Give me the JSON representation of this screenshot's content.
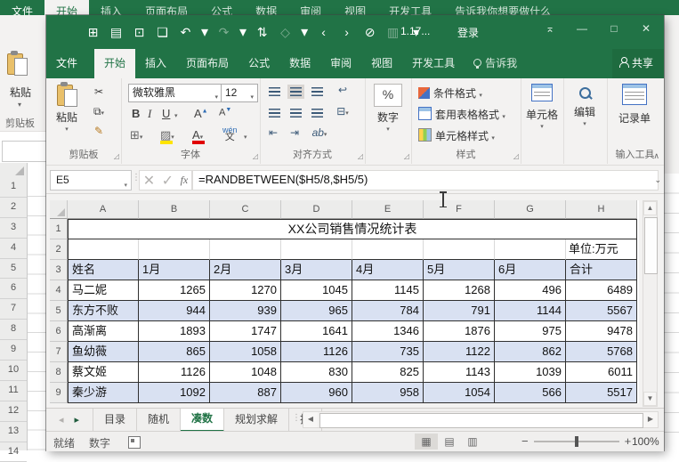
{
  "colors": {
    "excel_green": "#217346",
    "share_green": "#1e6b3f",
    "table_header_fill": "#d9e1f2",
    "table_border": "#303030",
    "active_sheet_tab_green": "#217346"
  },
  "background_window": {
    "top_tabs": [
      {
        "label": "文件",
        "kind": "file"
      },
      {
        "label": "开始",
        "active": true
      },
      {
        "label": "插入"
      },
      {
        "label": "页面布局"
      },
      {
        "label": "公式"
      },
      {
        "label": "数据"
      },
      {
        "label": "审阅"
      },
      {
        "label": "视图"
      },
      {
        "label": "开发工具"
      },
      {
        "label": "告诉我你想要做什么",
        "kind": "tellme"
      }
    ],
    "paste_label": "粘贴",
    "paste_dropdown": "▾",
    "clipboard_group_label": "剪贴板",
    "row_numbers": [
      "1",
      "2",
      "3",
      "4",
      "5",
      "6",
      "7",
      "8",
      "9",
      "10",
      "11",
      "12",
      "13",
      "14"
    ]
  },
  "title_bar": {
    "qat_icons": [
      {
        "name": "form-button-icon",
        "glyph": "⊞"
      },
      {
        "name": "save-icon",
        "glyph": "▤"
      },
      {
        "name": "quick-print-icon",
        "glyph": "⊡"
      },
      {
        "name": "print-preview-icon",
        "glyph": "❏"
      },
      {
        "name": "undo-icon",
        "glyph": "↶",
        "dropdown": true
      },
      {
        "name": "redo-icon",
        "glyph": "↷",
        "dropdown": true,
        "disabled": true
      },
      {
        "name": "sort-ascending-icon",
        "glyph": "⇅"
      },
      {
        "name": "shapes-icon",
        "glyph": "◇",
        "dropdown": true,
        "disabled": true
      },
      {
        "name": "previous-comment-icon",
        "glyph": "‹"
      },
      {
        "name": "next-comment-icon",
        "glyph": "›"
      },
      {
        "name": "delete-comment-icon",
        "glyph": "⊘"
      },
      {
        "name": "paste-special-icon",
        "glyph": "▥",
        "disabled": true
      },
      {
        "name": "qat-customize-icon",
        "glyph": "▾"
      }
    ],
    "document_title": "1.17...",
    "sign_in_label": "登录",
    "window_controls": [
      {
        "name": "ribbon-display-options-icon",
        "glyph": "⌅"
      },
      {
        "name": "minimize-icon",
        "glyph": "—"
      },
      {
        "name": "maximize-icon",
        "glyph": "□"
      },
      {
        "name": "close-icon",
        "glyph": "✕"
      }
    ]
  },
  "ribbon": {
    "tabs": [
      {
        "label": "文件",
        "kind": "file"
      },
      {
        "label": "开始",
        "active": true
      },
      {
        "label": "插入"
      },
      {
        "label": "页面布局"
      },
      {
        "label": "公式"
      },
      {
        "label": "数据"
      },
      {
        "label": "审阅"
      },
      {
        "label": "视图"
      },
      {
        "label": "开发工具"
      }
    ],
    "tell_me": "告诉我",
    "share": "共享",
    "clipboard": {
      "paste": "粘贴",
      "paste_dropdown": "▾",
      "label": "剪贴板"
    },
    "font": {
      "font_name": "微软雅黑",
      "font_size": "12",
      "bold": "B",
      "italic": "I",
      "underline": "U",
      "grow": "A",
      "shrink": "A",
      "pinyin_hint": "wén",
      "pinyin_char": "文",
      "label": "字体"
    },
    "alignment": {
      "label": "对齐方式",
      "orientation": "ab"
    },
    "number": {
      "symbol": "%",
      "button": "数字"
    },
    "styles": {
      "conditional": "条件格式",
      "format_as_table": "套用表格格式",
      "cell_styles": "单元格样式",
      "label": "样式"
    },
    "cells": {
      "button": "单元格"
    },
    "editing": {
      "button": "编辑"
    },
    "input_tools": {
      "button": "记录单",
      "label": "输入工具"
    }
  },
  "formula_bar": {
    "name_box": "E5",
    "cancel": "✕",
    "enter": "✓",
    "fx": "fx",
    "formula": "=RANDBETWEEN($H5/8,$H5/5)"
  },
  "grid": {
    "columns": [
      "A",
      "B",
      "C",
      "D",
      "E",
      "F",
      "G",
      "H"
    ],
    "rows": [
      "1",
      "2",
      "3",
      "4",
      "5",
      "6",
      "7",
      "8",
      "9"
    ],
    "title": "XX公司销售情况统计表",
    "unit_note": "单位:万元",
    "headers": [
      "姓名",
      "1月",
      "2月",
      "3月",
      "4月",
      "5月",
      "6月",
      "合计"
    ],
    "data": [
      {
        "name": "马二妮",
        "values": [
          1265,
          1270,
          1045,
          1145,
          1268,
          496
        ],
        "total": 6489
      },
      {
        "name": "东方不败",
        "values": [
          944,
          939,
          965,
          784,
          791,
          1144
        ],
        "total": 5567
      },
      {
        "name": "高渐离",
        "values": [
          1893,
          1747,
          1641,
          1346,
          1876,
          975
        ],
        "total": 9478
      },
      {
        "name": "鱼幼薇",
        "values": [
          865,
          1058,
          1126,
          735,
          1122,
          862
        ],
        "total": 5768
      },
      {
        "name": "蔡文姬",
        "values": [
          1126,
          1048,
          830,
          825,
          1143,
          1039
        ],
        "total": 6011
      },
      {
        "name": "秦少游",
        "values": [
          1092,
          887,
          960,
          958,
          1054,
          566
        ],
        "total": 5517
      }
    ]
  },
  "sheet_bar": {
    "nav_left": "◂",
    "nav_right": "▸",
    "tabs": [
      {
        "label": "目录"
      },
      {
        "label": "随机"
      },
      {
        "label": "凑数",
        "active": true
      },
      {
        "label": "规划求解"
      },
      {
        "label": "抽奖",
        "truncated": true
      }
    ],
    "more_label": "…",
    "add_label": "+"
  },
  "status_bar": {
    "ready": "就绪",
    "mode": "数字",
    "zoom": "100%",
    "views": [
      {
        "name": "normal-view-icon",
        "glyph": "▦",
        "active": true
      },
      {
        "name": "page-layout-view-icon",
        "glyph": "▤",
        "active": false
      },
      {
        "name": "page-break-view-icon",
        "glyph": "▥",
        "active": false
      }
    ]
  }
}
